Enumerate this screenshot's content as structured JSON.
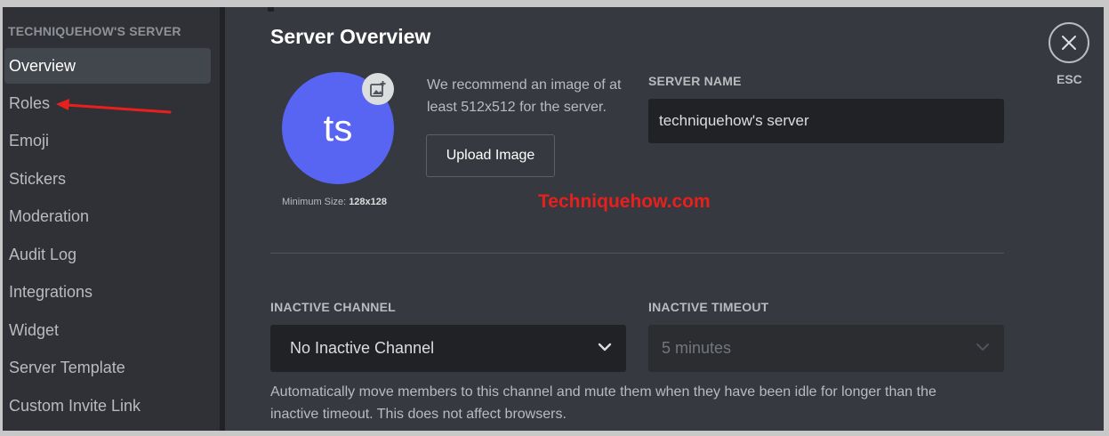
{
  "sidebar": {
    "server_name": "TECHNIQUEHOW'S SERVER",
    "items": [
      {
        "label": "Overview"
      },
      {
        "label": "Roles"
      },
      {
        "label": "Emoji"
      },
      {
        "label": "Stickers"
      },
      {
        "label": "Moderation"
      },
      {
        "label": "Audit Log"
      },
      {
        "label": "Integrations"
      },
      {
        "label": "Widget"
      },
      {
        "label": "Server Template"
      },
      {
        "label": "Custom Invite Link"
      }
    ],
    "active_item": "Overview"
  },
  "main": {
    "title": "Server Overview",
    "avatar": {
      "initials": "ts",
      "min_size_label": "Minimum Size:",
      "min_size_value": "128x128",
      "upload_icon": "image-plus-icon"
    },
    "recommendation": "We recommend an image of at least 512x512 for the server.",
    "upload_button": "Upload Image",
    "server_name_label": "SERVER NAME",
    "server_name_value": "techniquehow's server",
    "watermark": "Techniquehow.com",
    "inactive_channel_label": "INACTIVE CHANNEL",
    "inactive_channel_value": "No Inactive Channel",
    "inactive_timeout_label": "INACTIVE TIMEOUT",
    "inactive_timeout_value": "5 minutes",
    "help_text": "Automatically move members to this channel and mute them when they have been idle for longer than the inactive timeout. This does not affect browsers."
  },
  "close": {
    "icon": "close-icon",
    "label": "ESC"
  },
  "colors": {
    "background": "#36393f",
    "sidebar": "#2f3136",
    "accent": "#5865f2",
    "annotation": "#e8201d"
  }
}
